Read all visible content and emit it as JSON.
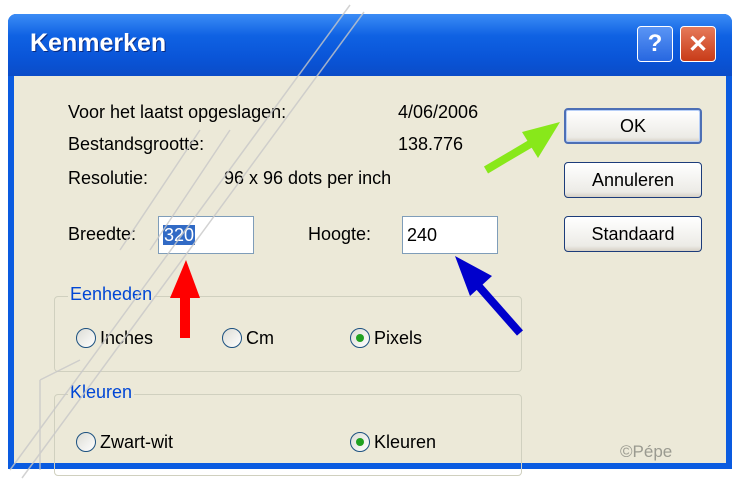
{
  "window": {
    "title": "Kenmerken",
    "help_label": "?",
    "close_label": "✕"
  },
  "info": {
    "last_saved_label": "Voor het laatst opgeslagen:",
    "last_saved_value": "4/06/2006",
    "size_label": "Bestandsgrootte:",
    "size_value": "138.776",
    "resolution_label": "Resolutie:",
    "resolution_value": "96 x 96 dots per inch"
  },
  "dimensions": {
    "width_label": "Breedte:",
    "width_value": "320",
    "height_label": "Hoogte:",
    "height_value": "240"
  },
  "units": {
    "legend": "Eenheden",
    "options": [
      "Inches",
      "Cm",
      "Pixels"
    ],
    "selected": "Pixels"
  },
  "colors": {
    "legend": "Kleuren",
    "options": [
      "Zwart-wit",
      "Kleuren"
    ],
    "selected": "Kleuren"
  },
  "buttons": {
    "ok": "OK",
    "cancel": "Annuleren",
    "default": "Standaard"
  },
  "annotation": {
    "credit": "©Pépe"
  },
  "accent": {
    "titlebar": "#0a55d8",
    "arrow_red": "#ff0000",
    "arrow_blue": "#0000cc",
    "arrow_green": "#88e81a"
  }
}
